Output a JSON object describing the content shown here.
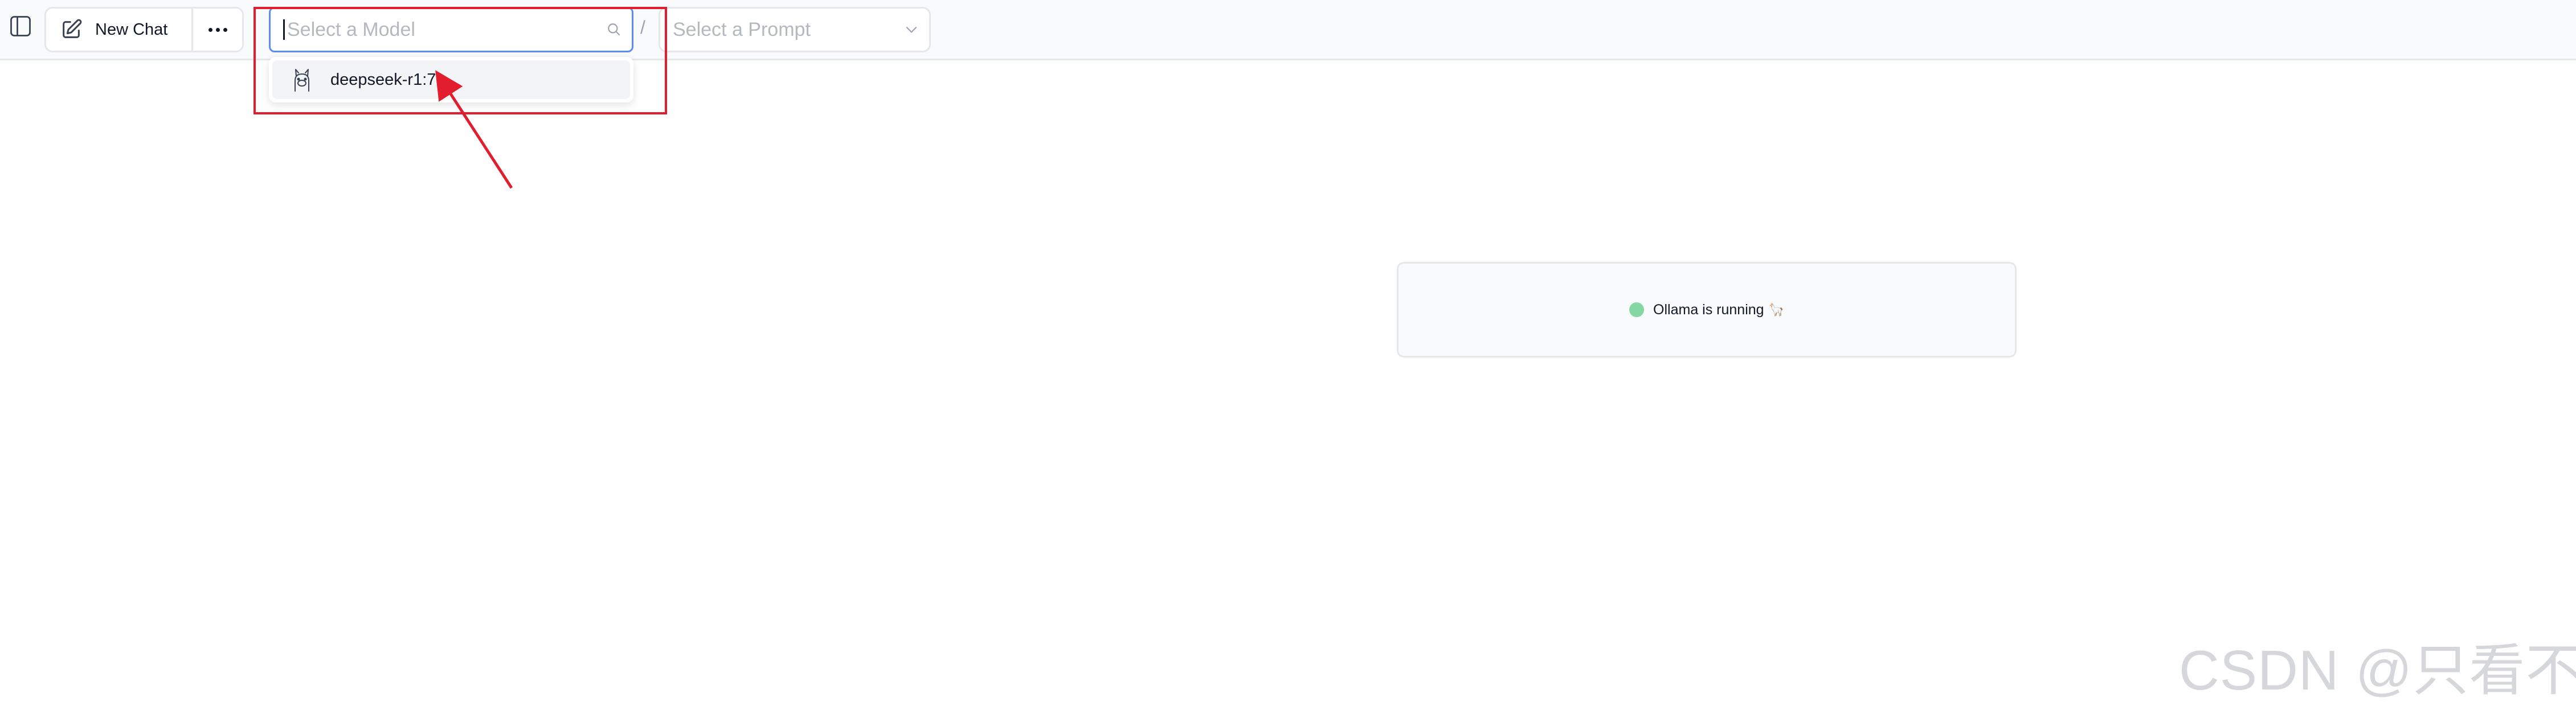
{
  "header": {
    "new_chat_label": "New Chat",
    "model_select": {
      "placeholder": "Select a Model",
      "value": ""
    },
    "separator": "/",
    "prompt_select": {
      "placeholder": "Select a Prompt"
    }
  },
  "dropdown": {
    "items": [
      {
        "label": "deepseek-r1:7b",
        "icon": "llama-icon"
      }
    ]
  },
  "status": {
    "text": "Ollama is running",
    "emoji": "🦙",
    "indicator_color": "#86d8a3"
  },
  "annotation": {
    "color": "#e11d2e"
  },
  "watermark": {
    "text": "CSDN @只看不学"
  }
}
